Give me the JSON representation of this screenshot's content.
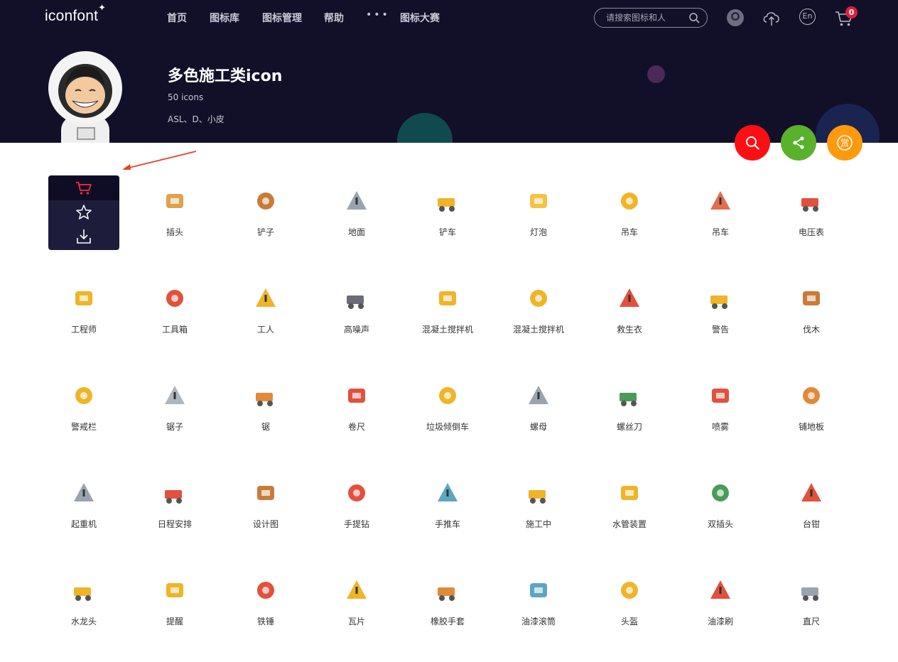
{
  "nav": {
    "logo": "iconfont",
    "items": [
      "首页",
      "图标库",
      "图标管理",
      "帮助"
    ],
    "more": "•••",
    "contest": "图标大赛",
    "search_placeholder": "请搜索图标和人",
    "lang": "En",
    "cart_count": "0"
  },
  "project": {
    "title": "多色施工类icon",
    "count": "50 icons",
    "authors": "ASL、D、小皮"
  },
  "icons": [
    {
      "name": "插头",
      "color": "#e0a24a"
    },
    {
      "name": "铲子",
      "color": "#c97b3a"
    },
    {
      "name": "地面",
      "color": "#9aa4b0"
    },
    {
      "name": "铲车",
      "color": "#f0b429"
    },
    {
      "name": "灯泡",
      "color": "#f5c342"
    },
    {
      "name": "吊车",
      "color": "#f0b429"
    },
    {
      "name": "吊车",
      "color": "#e26d4f"
    },
    {
      "name": "电压表",
      "color": "#e2513c"
    },
    {
      "name": "工程师",
      "color": "#f0b429"
    },
    {
      "name": "工具箱",
      "color": "#e2513c"
    },
    {
      "name": "工人",
      "color": "#f0b429"
    },
    {
      "name": "高噪声",
      "color": "#6b6b7a"
    },
    {
      "name": "混凝土搅拌机",
      "color": "#f0b429"
    },
    {
      "name": "混凝土搅拌机",
      "color": "#f0b429"
    },
    {
      "name": "救生衣",
      "color": "#e2513c"
    },
    {
      "name": "警告",
      "color": "#f0b429"
    },
    {
      "name": "伐木",
      "color": "#c97b3a"
    },
    {
      "name": "警戒栏",
      "color": "#f0b429"
    },
    {
      "name": "锯子",
      "color": "#b0b6be"
    },
    {
      "name": "锯",
      "color": "#e08a3a"
    },
    {
      "name": "卷尺",
      "color": "#e2513c"
    },
    {
      "name": "垃圾倾倒车",
      "color": "#f0b429"
    },
    {
      "name": "螺母",
      "color": "#9aa4b0"
    },
    {
      "name": "螺丝刀",
      "color": "#4a9b5a"
    },
    {
      "name": "喷雾",
      "color": "#e2513c"
    },
    {
      "name": "铺地板",
      "color": "#e08a3a"
    },
    {
      "name": "起重机",
      "color": "#9aa4b0"
    },
    {
      "name": "日程安排",
      "color": "#e2513c"
    },
    {
      "name": "设计图",
      "color": "#c97b3a"
    },
    {
      "name": "手提钻",
      "color": "#e2513c"
    },
    {
      "name": "手推车",
      "color": "#5aa6c4"
    },
    {
      "name": "施工中",
      "color": "#f0b429"
    },
    {
      "name": "水管装置",
      "color": "#f0b429"
    },
    {
      "name": "双插头",
      "color": "#4a9b5a"
    },
    {
      "name": "台钳",
      "color": "#e2513c"
    },
    {
      "name": "水龙头",
      "color": "#f0b429"
    },
    {
      "name": "提醒",
      "color": "#f0b429"
    },
    {
      "name": "铁锤",
      "color": "#e2513c"
    },
    {
      "name": "瓦片",
      "color": "#f0b429"
    },
    {
      "name": "橡胶手套",
      "color": "#e08a3a"
    },
    {
      "name": "油漆滚筒",
      "color": "#5aa6c4"
    },
    {
      "name": "头盔",
      "color": "#f0b429"
    },
    {
      "name": "油漆刷",
      "color": "#e2513c"
    },
    {
      "name": "直尺",
      "color": "#9aa4b0"
    }
  ],
  "colors": {
    "header_bg": "#120f28",
    "fab_search": "#ff0f14",
    "fab_share": "#5ab12c",
    "fab_reward": "#ff9a0e",
    "accent_red": "#e0203a"
  }
}
